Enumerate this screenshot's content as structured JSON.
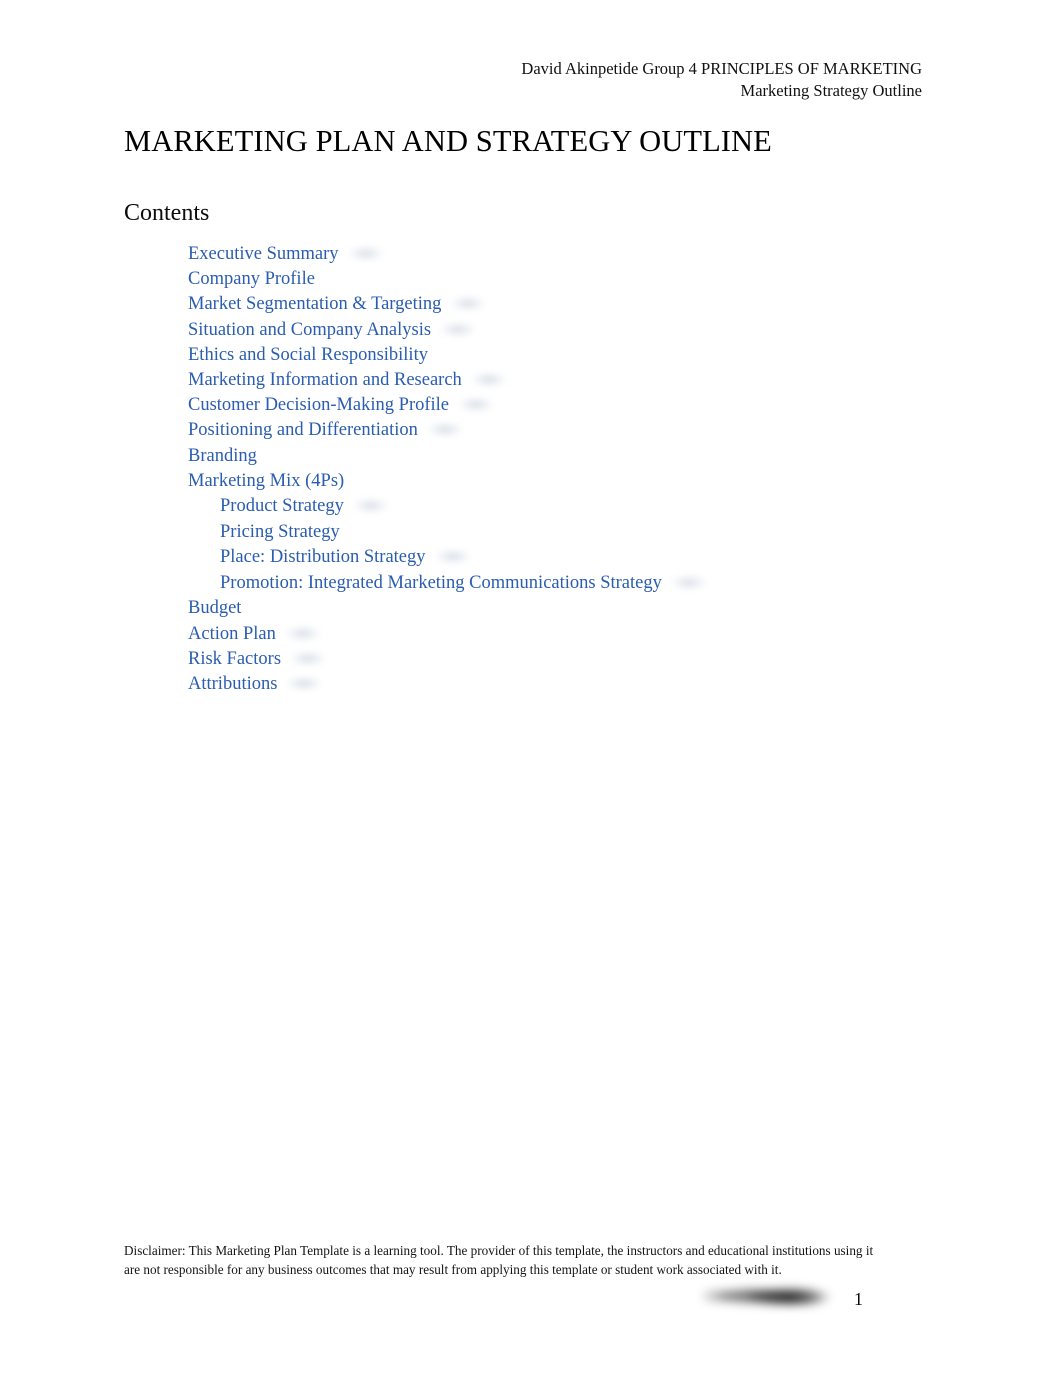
{
  "document": {
    "header": {
      "line1": "David Akinpetide Group 4 PRINCIPLES OF MARKETING",
      "line2": "Marketing Strategy Outline"
    },
    "title": "MARKETING PLAN AND STRATEGY OUTLINE",
    "contents_heading": "Contents",
    "toc": [
      {
        "label": "Executive Summary",
        "level": 1,
        "redacted_page_number": true
      },
      {
        "label": "Company Profile",
        "level": 1,
        "redacted_page_number": false
      },
      {
        "label": "Market Segmentation & Targeting",
        "level": 1,
        "redacted_page_number": true
      },
      {
        "label": "Situation and Company Analysis",
        "level": 1,
        "redacted_page_number": true
      },
      {
        "label": "Ethics and Social Responsibility",
        "level": 1,
        "redacted_page_number": false
      },
      {
        "label": "Marketing Information and Research",
        "level": 1,
        "redacted_page_number": true
      },
      {
        "label": "Customer Decision-Making Profile",
        "level": 1,
        "redacted_page_number": true
      },
      {
        "label": "Positioning and Differentiation",
        "level": 1,
        "redacted_page_number": true
      },
      {
        "label": "Branding",
        "level": 1,
        "redacted_page_number": false
      },
      {
        "label": "Marketing Mix (4Ps)",
        "level": 1,
        "redacted_page_number": false
      },
      {
        "label": "Product Strategy",
        "level": 2,
        "redacted_page_number": true
      },
      {
        "label": "Pricing Strategy",
        "level": 2,
        "redacted_page_number": false
      },
      {
        "label": "Place: Distribution Strategy",
        "level": 2,
        "redacted_page_number": true
      },
      {
        "label": "Promotion: Integrated Marketing Communications Strategy",
        "level": 2,
        "redacted_page_number": true
      },
      {
        "label": "Budget",
        "level": 1,
        "redacted_page_number": false
      },
      {
        "label": "Action Plan",
        "level": 1,
        "redacted_page_number": true
      },
      {
        "label": "Risk Factors",
        "level": 1,
        "redacted_page_number": true
      },
      {
        "label": "Attributions",
        "level": 1,
        "redacted_page_number": true
      }
    ],
    "footer": {
      "disclaimer": "Disclaimer: This Marketing Plan Template is a learning tool. The provider of this template, the instructors and educational institutions using it are not responsible for any business outcomes that may result from applying this template or student work associated with it.",
      "page_number": "1",
      "redaction_present": true
    },
    "colors": {
      "page_background": "#ffffff",
      "body_text": "#000000",
      "toc_link": "#2a5db0"
    }
  }
}
